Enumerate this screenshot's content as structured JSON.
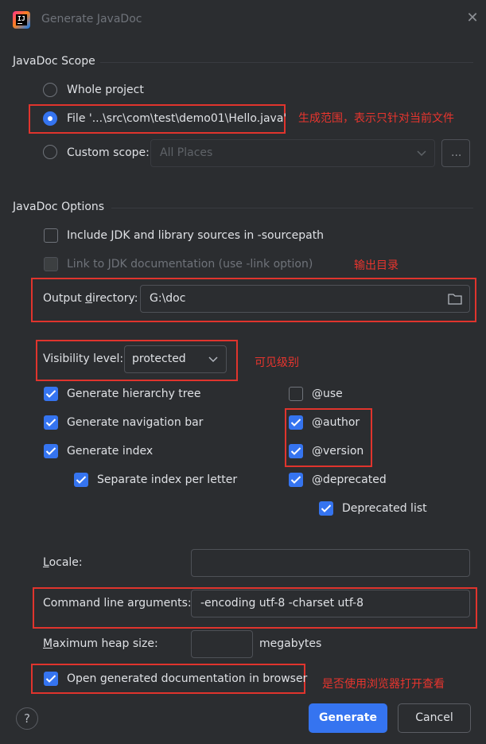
{
  "window": {
    "title": "Generate JavaDoc",
    "close_glyph": "✕"
  },
  "scope": {
    "section_title": "JavaDoc Scope",
    "whole_project": "Whole project",
    "file": "File '...\\src\\com\\test\\demo01\\Hello.java'",
    "custom_scope": "Custom scope:",
    "custom_scope_value": "All Places",
    "browse_label": "...",
    "selected": "file"
  },
  "options": {
    "section_title": "JavaDoc Options",
    "include_jdk": "Include JDK and library sources in -sourcepath",
    "link_jdk": "Link to JDK documentation (use -link option)",
    "output_dir_label_pre": "Output ",
    "output_dir_label_u": "d",
    "output_dir_label_post": "irectory:",
    "output_dir_value": "G:\\doc",
    "visibility_label": "Visibility level:",
    "visibility_value": "protected",
    "gen_hierarchy": "Generate hierarchy tree",
    "gen_navbar": "Generate navigation bar",
    "gen_index": "Generate index",
    "sep_index": "Separate index per letter",
    "tag_use": "@use",
    "tag_author": "@author",
    "tag_version": "@version",
    "tag_deprecated": "@deprecated",
    "deprecated_list": "Deprecated list",
    "locale_label_u": "L",
    "locale_label_post": "ocale:",
    "locale_value": "",
    "cmd_label": "Command line arguments:",
    "cmd_value": "-encoding utf-8 -charset utf-8",
    "heap_label_u": "M",
    "heap_label_post": "aximum heap size:",
    "heap_value": "",
    "heap_unit": "megabytes",
    "open_browser": "Open generated documentation in browser"
  },
  "annotations": {
    "scope_note": "生成范围，表示只针对当前文件",
    "output_note": "输出目录",
    "visibility_note": "可见级别",
    "browser_note": "是否使用浏览器打开查看"
  },
  "buttons": {
    "help": "?",
    "generate": "Generate",
    "cancel": "Cancel"
  },
  "colors": {
    "accent": "#3574f0",
    "annotation": "#e0342d",
    "background": "#2b2d30"
  }
}
